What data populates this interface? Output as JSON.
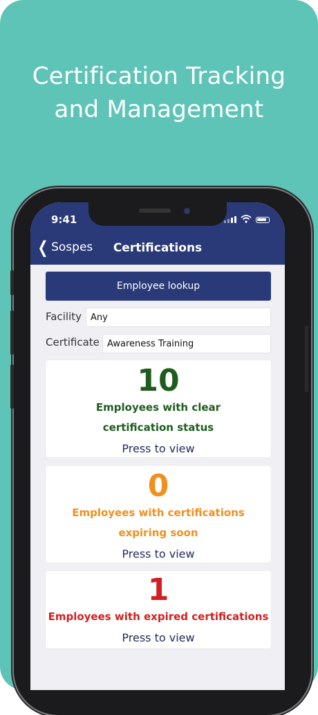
{
  "headline": {
    "line1": "Certification Tracking",
    "line2": "and Management"
  },
  "status_bar": {
    "time": "9:41"
  },
  "nav": {
    "back_label": "Sospes",
    "title": "Certifications"
  },
  "lookup_button": "Employee lookup",
  "filters": {
    "facility_label": "Facility",
    "facility_value": "Any",
    "certificate_label": "Certificate",
    "certificate_value": "Awareness Training"
  },
  "cards": [
    {
      "count": "10",
      "line1": "Employees with clear",
      "line2": "certification status",
      "action": "Press to view",
      "color": "#1e5c1e"
    },
    {
      "count": "0",
      "line1": "Employees with certifications",
      "line2": "expiring soon",
      "action": "Press to view",
      "color": "#f0901e"
    },
    {
      "count": "1",
      "line1": "Employees with expired certifications",
      "action": "Press to view",
      "color": "#d02020"
    }
  ],
  "colors": {
    "background": "#5fc4b8",
    "navbar": "#2a3a78"
  }
}
